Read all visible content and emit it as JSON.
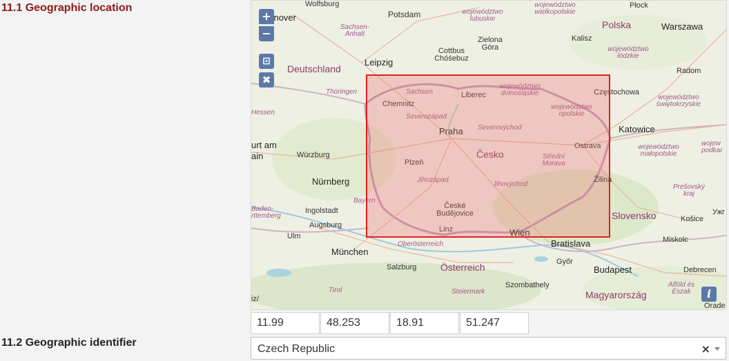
{
  "sections": {
    "location_title": "11.1 Geographic location",
    "identifier_title": "11.2 Geographic identifier"
  },
  "map": {
    "controls": {
      "zoom_in": "+",
      "zoom_out": "−",
      "crop": "⊡",
      "clear": "✖",
      "info": "i"
    },
    "labels": {
      "hannover": "annover",
      "wolfsburg": "Wolfsburg",
      "potsdam": "Potsdam",
      "wiel": "województwo wielkopolskie",
      "lubuskie": "województwo lubuskie",
      "plock": "Płock",
      "polska": "Polska",
      "warszawa": "Warszawa",
      "sachsen_anhalt": "Sachsen-Anhalt",
      "zielona": "Zielona Góra",
      "kalisz": "Kalisz",
      "lodzkie": "województwo łódzkie",
      "deutschland": "Deutschland",
      "leipzig": "Leipzig",
      "cottbus": "Cottbus Chóśebuz",
      "radom": "Radom",
      "thuringen": "Thüringen",
      "sachsen": "Sachsen",
      "liberec": "Liberec",
      "dolnoslaskie": "województwo dolnośląskie",
      "czestochowa": "Częstochowa",
      "swietokrzyskie": "województwo świętokrzyskie",
      "hessen": "Hessen",
      "chemnitz": "Chemnitz",
      "opolskie": "województwo opolskie",
      "severozapad": "Severozápad",
      "praha": "Praha",
      "severovychod": "Severovýchod",
      "katowice": "Katowice",
      "furt": "urt am",
      "main": "ain",
      "wurzburg": "Würzburg",
      "cesko": "Česko",
      "ostrava": "Ostrava",
      "malopolskie": "województwo małopolskie",
      "podkar": "wojew podkar",
      "plzen": "Plzeň",
      "stredni": "Střední Morava",
      "nurnberg": "Nürnberg",
      "jihozapad": "Jihozápad",
      "jihovychod": "Jihovýchod",
      "zilina": "Žilina",
      "presov": "Prešovský kraj",
      "bayern": "Bayern",
      "baden": "Baden-rttemberg",
      "ingolstadt": "Ingolstadt",
      "ceske": "České Budějovice",
      "slovensko": "Slovensko",
      "kosice": "Košice",
      "uzh": "Ужг",
      "augsburg": "Augsburg",
      "linz": "Linz",
      "wien": "Wien",
      "bratislava": "Bratislava",
      "ulm": "Ulm",
      "miskolc": "Miskolc",
      "oberosterreich": "Oberösterreich",
      "munchen": "München",
      "salzburg": "Salzburg",
      "osterreich": "Österreich",
      "gyor": "Győr",
      "budapest": "Budapest",
      "debrecen": "Debrecen",
      "steiermark": "Steiermark",
      "tirol": "Tirol",
      "szombathely": "Szombathely",
      "magyarorszag": "Magyarország",
      "alfold": "Alföld és Észak",
      "orade": "Orade",
      "iz": "iz/"
    }
  },
  "bbox": {
    "west": "11.99",
    "south": "48.253",
    "east": "18.91",
    "north": "51.247"
  },
  "identifier": {
    "value": "Czech Republic",
    "clear": "×"
  },
  "colors": {
    "title_accent": "#8b1a1a",
    "bbox_border": "#e02020",
    "control_bg": "#5b79a8"
  }
}
